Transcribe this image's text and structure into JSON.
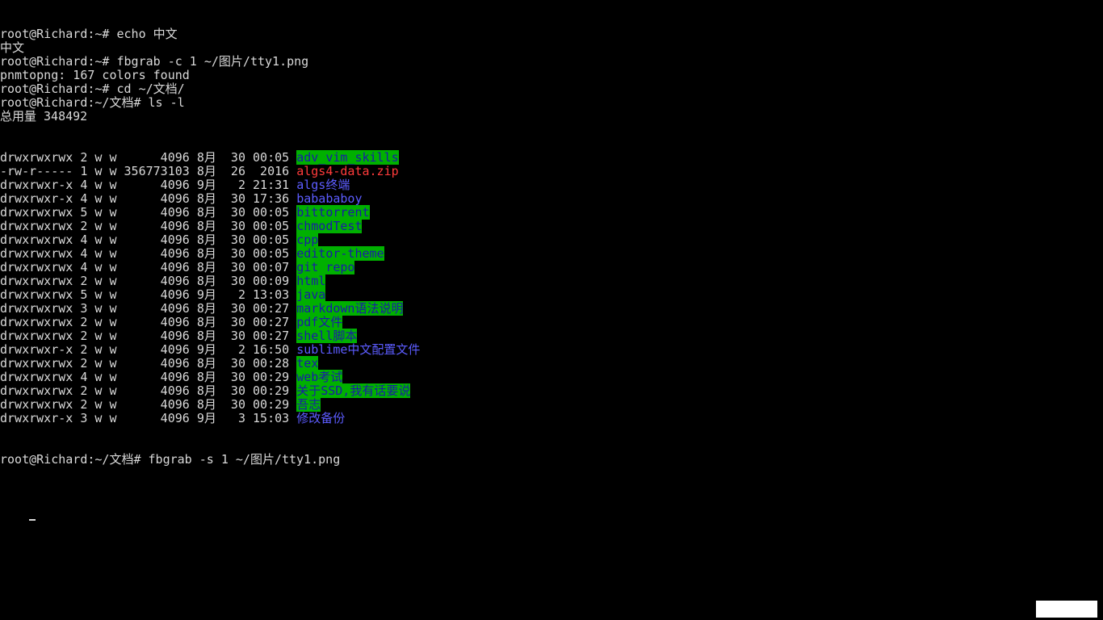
{
  "terminal": {
    "lines_before": [
      "root@Richard:~# echo 中文",
      "中文",
      "root@Richard:~# fbgrab -c 1 ~/图片/tty1.png",
      "pnmtopng: 167 colors found",
      "root@Richard:~# cd ~/文档/",
      "root@Richard:~/文档# ls -l",
      "总用量 348492"
    ],
    "listing": [
      {
        "meta": "drwxrwxrwx 2 w w      4096 8月  30 00:05 ",
        "name": "adv_vim_skills",
        "style": "hl-green"
      },
      {
        "meta": "-rw-r----- 1 w w 356773103 8月  26  2016 ",
        "name": "algs4-data.zip",
        "style": "archive"
      },
      {
        "meta": "drwxrwxr-x 4 w w      4096 9月   2 21:31 ",
        "name": "algs终端",
        "style": "dir-plain"
      },
      {
        "meta": "drwxrwxr-x 4 w w      4096 8月  30 17:36 ",
        "name": "babababoy",
        "style": "dir-plain"
      },
      {
        "meta": "drwxrwxrwx 5 w w      4096 8月  30 00:05 ",
        "name": "bittorrent",
        "style": "hl-green"
      },
      {
        "meta": "drwxrwxrwx 2 w w      4096 8月  30 00:05 ",
        "name": "chmodTest",
        "style": "hl-green"
      },
      {
        "meta": "drwxrwxrwx 4 w w      4096 8月  30 00:05 ",
        "name": "cpp",
        "style": "hl-green"
      },
      {
        "meta": "drwxrwxrwx 4 w w      4096 8月  30 00:05 ",
        "name": "editor-theme",
        "style": "hl-green"
      },
      {
        "meta": "drwxrwxrwx 4 w w      4096 8月  30 00:07 ",
        "name": "git_repo",
        "style": "hl-green"
      },
      {
        "meta": "drwxrwxrwx 2 w w      4096 8月  30 00:09 ",
        "name": "html",
        "style": "hl-green"
      },
      {
        "meta": "drwxrwxrwx 5 w w      4096 9月   2 13:03 ",
        "name": "java",
        "style": "hl-green"
      },
      {
        "meta": "drwxrwxrwx 3 w w      4096 8月  30 00:27 ",
        "name": "markdown语法说明",
        "style": "hl-green"
      },
      {
        "meta": "drwxrwxrwx 2 w w      4096 8月  30 00:27 ",
        "name": "pdf文件",
        "style": "hl-green"
      },
      {
        "meta": "drwxrwxrwx 2 w w      4096 8月  30 00:27 ",
        "name": "shell脚本",
        "style": "hl-green"
      },
      {
        "meta": "drwxrwxr-x 2 w w      4096 9月   2 16:50 ",
        "name": "sublime中文配置文件",
        "style": "dir-plain"
      },
      {
        "meta": "drwxrwxrwx 2 w w      4096 8月  30 00:28 ",
        "name": "tex",
        "style": "hl-green"
      },
      {
        "meta": "drwxrwxrwx 4 w w      4096 8月  30 00:29 ",
        "name": "web考试",
        "style": "hl-green"
      },
      {
        "meta": "drwxrwxrwx 2 w w      4096 8月  30 00:29 ",
        "name": "关于SSD,我有话要说",
        "style": "hl-green"
      },
      {
        "meta": "drwxrwxrwx 2 w w      4096 8月  30 00:29 ",
        "name": "吾志",
        "style": "hl-green"
      },
      {
        "meta": "drwxrwxr-x 3 w w      4096 9月   3 15:03 ",
        "name": "修改备份",
        "style": "dir-plain"
      }
    ],
    "last_command": "root@Richard:~/文档# fbgrab -s 1 ~/图片/tty1.png",
    "colors": {
      "background": "#000000",
      "foreground": "#d9d9d9",
      "highlight_bg": "#00b000",
      "highlight_fg": "#1a1aa8",
      "directory": "#5c5cff",
      "archive": "#ff3b3b"
    }
  }
}
